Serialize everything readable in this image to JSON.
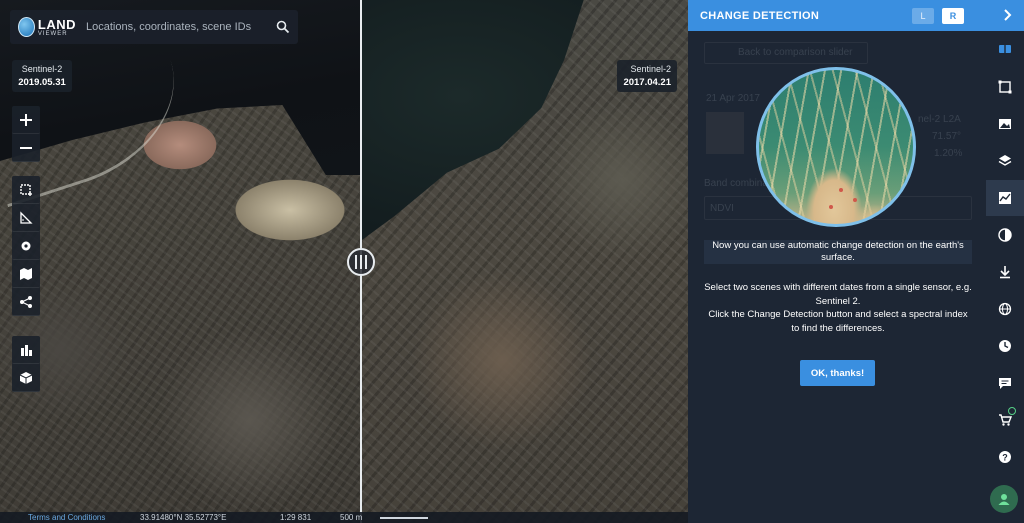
{
  "map": {
    "search_placeholder": "Locations, coordinates, scene IDs",
    "logo_big": "LAND",
    "logo_small": "VIEWER",
    "scene_left": {
      "sensor": "Sentinel-2",
      "date": "2019.05.31"
    },
    "scene_right": {
      "sensor": "Sentinel-2",
      "date": "2017.04.21"
    },
    "status": {
      "terms": "Terms and Conditions",
      "coords": "33.91480°N 35.52773°E",
      "scale": "1:29 831",
      "distance": "500 m"
    }
  },
  "panel": {
    "title": "CHANGE DETECTION",
    "btn_l": "L",
    "btn_r": "R",
    "notice_line": "Now you can use automatic change detection on the earth's surface.",
    "body_1": "Select two scenes with different dates from a single sensor, e.g. Sentinel 2.",
    "body_2": "Click the Change Detection button and select a spectral index to find the differences.",
    "ok_label": "OK, thanks!",
    "faint": {
      "back": "Back to comparison slider",
      "date": "21 Apr 2017",
      "l2a": "nel-2 L2A",
      "pct1": "71.57°",
      "pct2": "1.20%",
      "band": "Band combina",
      "ndvi": "NDVI"
    }
  },
  "colors": {
    "accent": "#3a8fe0",
    "panel_bg": "#1d2634",
    "rail_active": "#2d3a4d"
  },
  "rail": {
    "icons": [
      "compare-icon",
      "crop-icon",
      "image-icon",
      "layers-icon",
      "chart-icon",
      "contrast-icon",
      "download-icon",
      "globe-icon",
      "time-icon",
      "chat-icon",
      "cart-icon",
      "help-icon",
      "user-icon"
    ]
  }
}
